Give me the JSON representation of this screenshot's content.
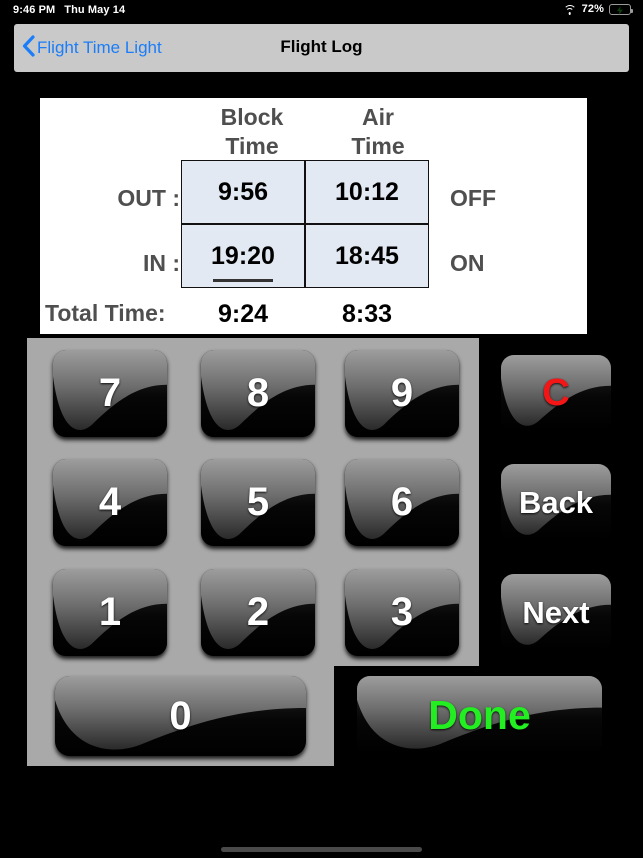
{
  "status_bar": {
    "time": "9:46 PM",
    "date": "Thu May 14",
    "wifi_icon": "wifi-icon",
    "battery_percent": "72%",
    "battery_icon": "battery-charging-icon",
    "battery_level": 72
  },
  "nav_bar": {
    "back_icon": "chevron-left-icon",
    "back_label": "Flight Time Light",
    "title": "Flight Log",
    "back_color": "#1b7df8"
  },
  "info_card": {
    "column_headers": [
      {
        "line1": "Block",
        "line2": "Time"
      },
      {
        "line1": "Air",
        "line2": "Time"
      }
    ],
    "rows": [
      {
        "label": "OUT :",
        "block_time": "9:56",
        "air_time": "10:12",
        "side_label": "OFF",
        "active": false
      },
      {
        "label": "IN :",
        "block_time": "19:20",
        "air_time": "18:45",
        "side_label": "ON",
        "active": true
      }
    ],
    "total_label": "Total Time:",
    "total_block_time": "9:24",
    "total_air_time": "8:33",
    "cell_fill_color": "#e2e9f3"
  },
  "keypad": {
    "digits": [
      "7",
      "8",
      "9",
      "4",
      "5",
      "6",
      "1",
      "2",
      "3"
    ],
    "zero": "0",
    "side_buttons": [
      {
        "label": "C",
        "color": "#f41616",
        "name": "clear-button"
      },
      {
        "label": "Back",
        "color": "#ffffff",
        "name": "back-key-button"
      },
      {
        "label": "Next",
        "color": "#ffffff",
        "name": "next-key-button"
      }
    ],
    "done": {
      "label": "Done",
      "color": "#22ee22"
    }
  }
}
